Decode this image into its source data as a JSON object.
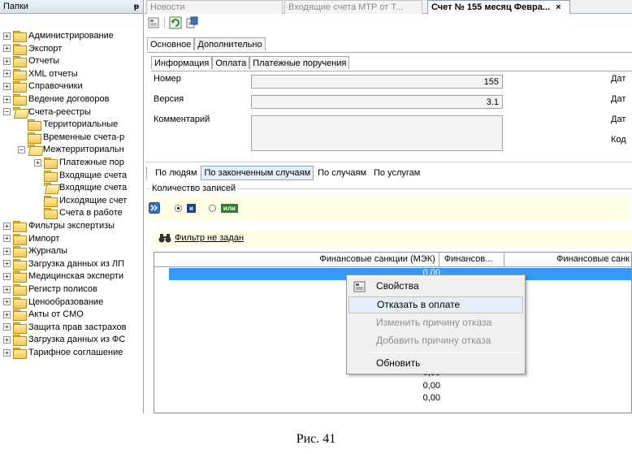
{
  "left_panel": {
    "title": "Папки",
    "pin_glyph": "ᵽ",
    "items": [
      {
        "label": "Администрирование",
        "expander": "+",
        "open": false
      },
      {
        "label": "Экспорт",
        "expander": "+",
        "open": false
      },
      {
        "label": "Отчеты",
        "expander": "+",
        "open": false
      },
      {
        "label": "XML отчеты",
        "expander": "+",
        "open": false
      },
      {
        "label": "Справочники",
        "expander": "+",
        "open": false
      },
      {
        "label": "Ведение договоров",
        "expander": "+",
        "open": false
      },
      {
        "label": "Счета-реестры",
        "expander": "−",
        "open": true
      },
      {
        "label": "Территориальные",
        "expander": "",
        "open": false
      },
      {
        "label": "Временные счета-р",
        "expander": "",
        "open": false
      },
      {
        "label": "Межтерриториальн",
        "expander": "−",
        "open": true
      },
      {
        "label": "Платежные пор",
        "expander": "+",
        "open": false
      },
      {
        "label": "Входящие счета",
        "expander": "",
        "open": false
      },
      {
        "label": "Входящие счета",
        "expander": "",
        "open": true
      },
      {
        "label": "Исходящие счет",
        "expander": "",
        "open": false
      },
      {
        "label": "Счета в работе",
        "expander": "",
        "open": false
      },
      {
        "label": "Фильтры экспертизы",
        "expander": "+",
        "open": false
      },
      {
        "label": "Импорт",
        "expander": "+",
        "open": false
      },
      {
        "label": "Журналы",
        "expander": "+",
        "open": false
      },
      {
        "label": "Загрузка данных из ЛП",
        "expander": "+",
        "open": false
      },
      {
        "label": "Медицинская эксперти",
        "expander": "+",
        "open": false
      },
      {
        "label": "Регистр полисов",
        "expander": "+",
        "open": false
      },
      {
        "label": "Ценообразование",
        "expander": "+",
        "open": false
      },
      {
        "label": "Акты от СМО",
        "expander": "+",
        "open": false
      },
      {
        "label": "Защита прав застрахов",
        "expander": "+",
        "open": false
      },
      {
        "label": "Загрузка данных из ФС",
        "expander": "+",
        "open": false
      },
      {
        "label": "Тарифное соглашение",
        "expander": "+",
        "open": false
      }
    ]
  },
  "doc_tabs": {
    "tab1": "Новости",
    "tab2": "Входящие счета МТР от Т...",
    "tab3": "Счет № 155 месяц Февра...",
    "close": "×"
  },
  "main_tabs": {
    "basic": "Основное",
    "extra": "Дополнительно"
  },
  "sub_tabs": {
    "info": "Информация",
    "payment": "Оплата",
    "orders": "Платежные поручения"
  },
  "fields": {
    "number_label": "Номер",
    "number_value": "155",
    "version_label": "Версия",
    "version_value": "3.1",
    "comment_label": "Комментарий",
    "comment_value": "",
    "right_label_1": "Дат",
    "right_label_2": "Дат",
    "right_label_3": "Дат",
    "right_label_4": "Код"
  },
  "mode_tabs": {
    "people": "По людям",
    "finished": "По законченным случаям",
    "cases": "По случаям",
    "services": "По услугам"
  },
  "records": {
    "title": "Количество записей",
    "and_label": "и",
    "or_label": "или",
    "and_color": "#1f3f8f",
    "or_color": "#2e7d32"
  },
  "filter": {
    "link": "Фильтр не задан"
  },
  "grid": {
    "columns": [
      "Финансовые санкции (МЭК)",
      "Финансов...",
      "Финансовые санк"
    ],
    "rows": [
      "0,00",
      "",
      "",
      "",
      "",
      "",
      "",
      "",
      "0,00",
      "0,00",
      "0,00"
    ]
  },
  "context_menu": {
    "properties": "Свойства",
    "refuse": "Отказать в оплате",
    "change_reason": "Изменить причину отказа",
    "add_reason": "Добавить причину отказа",
    "refresh": "Обновить"
  },
  "caption": "Рис. 41"
}
